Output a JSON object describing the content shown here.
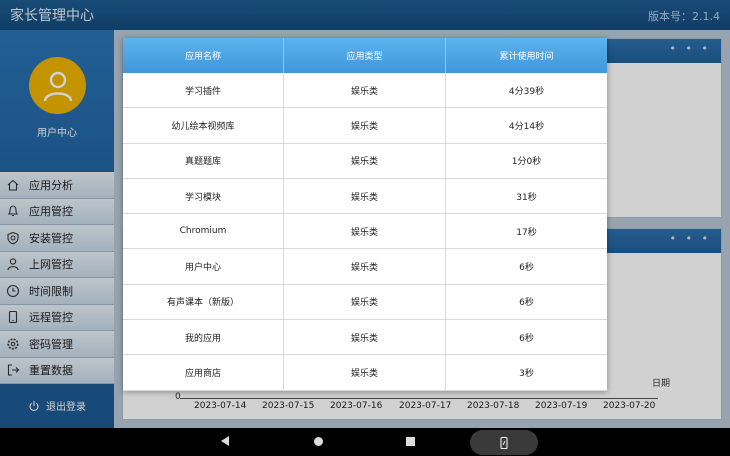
{
  "app": {
    "title": "家长管理中心",
    "version": "版本号：2.1.4"
  },
  "sidebar": {
    "user_label": "用户中心",
    "items": [
      {
        "label": "应用分析",
        "icon": "home-icon"
      },
      {
        "label": "应用管控",
        "icon": "bell-icon"
      },
      {
        "label": "安装管控",
        "icon": "shield-icon"
      },
      {
        "label": "上网管控",
        "icon": "person-icon"
      },
      {
        "label": "时间限制",
        "icon": "clock-icon"
      },
      {
        "label": "远程管控",
        "icon": "phone-icon"
      },
      {
        "label": "密码管理",
        "icon": "gear-icon"
      },
      {
        "label": "重置数据",
        "icon": "exit-icon"
      }
    ],
    "logout_label": "退出登录"
  },
  "chart_bg": {
    "x_unit": "日期",
    "y_zero": "0",
    "dates": [
      "2023-07-14",
      "2023-07-15",
      "2023-07-16",
      "2023-07-17",
      "2023-07-18",
      "2023-07-19",
      "2023-07-20"
    ]
  },
  "table": {
    "headers": [
      "应用名称",
      "应用类型",
      "累计使用时间"
    ],
    "rows": [
      [
        "学习插件",
        "娱乐类",
        "4分39秒"
      ],
      [
        "幼儿绘本视频库",
        "娱乐类",
        "4分14秒"
      ],
      [
        "真题题库",
        "娱乐类",
        "1分0秒"
      ],
      [
        "学习模块",
        "娱乐类",
        "31秒"
      ],
      [
        "Chromium",
        "娱乐类",
        "17秒"
      ],
      [
        "用户中心",
        "娱乐类",
        "6秒"
      ],
      [
        "有声课本（新版）",
        "娱乐类",
        "6秒"
      ],
      [
        "我的应用",
        "娱乐类",
        "6秒"
      ],
      [
        "应用商店",
        "娱乐类",
        "3秒"
      ]
    ]
  },
  "card": {
    "menu_dots": "• • •"
  }
}
